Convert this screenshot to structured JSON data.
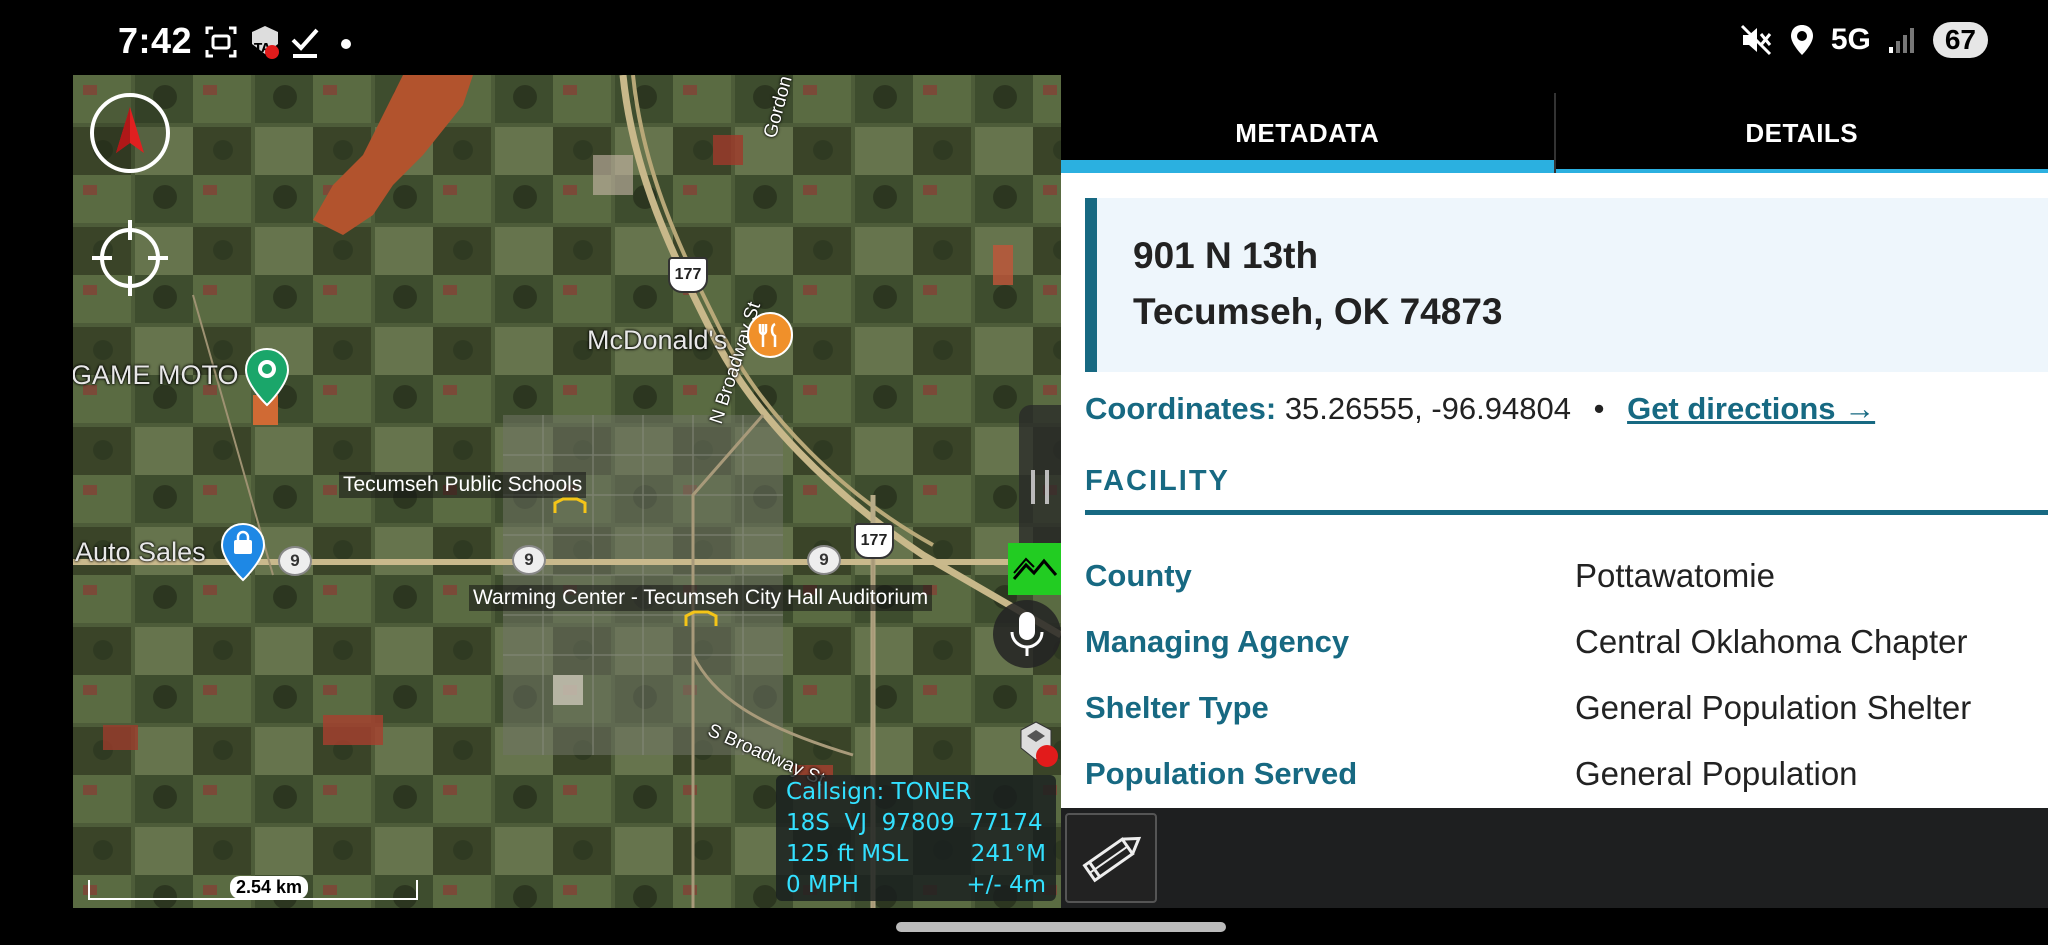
{
  "status_bar": {
    "time": "7:42",
    "network": "5G",
    "battery": "67",
    "icons": [
      "screenshot-icon",
      "tak-notification-icon",
      "check-icon",
      "dot-icon",
      "mute-icon",
      "location-icon",
      "signal-icon",
      "battery-icon"
    ]
  },
  "map": {
    "labels": {
      "mcdonalds": "McDonald's",
      "game_moto": "GAME MOTO",
      "auto_sales": "Auto Sales",
      "gordon_cooper": "Gordon Cooper D",
      "n_broadway": "N Broadway St",
      "s_broadway": "S Broadway St"
    },
    "poi": {
      "schools": "Tecumseh Public Schools",
      "warming_center": "Warming Center - Tecumseh City Hall Auditorium"
    },
    "shields": {
      "hwy177_north": "177",
      "hwy177_south": "177",
      "route9_a": "9",
      "route9_b": "9",
      "route9_c": "9"
    },
    "scale": "2.54 km",
    "info": {
      "callsign": "Callsign: TONER",
      "grid": "18S  VJ  97809  77174",
      "altitude": "125 ft MSL",
      "heading": "241°M",
      "speed": "0 MPH",
      "accuracy": "+/- 4m"
    },
    "colors": {
      "info_text": "#33e0ff",
      "green_tool": "#22cc22",
      "food_pin": "#f0902a",
      "park_pin": "#1aa66a",
      "shop_pin": "#1e88e5"
    }
  },
  "tabs": {
    "metadata": "METADATA",
    "details": "DETAILS"
  },
  "details": {
    "address_line1": "901 N 13th",
    "address_line2": "Tecumseh, OK 74873",
    "coordinates_label": "Coordinates:",
    "coordinates_value": "35.26555, -96.94804",
    "separator": "•",
    "directions_link": "Get directions →",
    "section_title": "FACILITY",
    "facility": [
      {
        "key": "County",
        "value": "Pottawatomie"
      },
      {
        "key": "Managing Agency",
        "value": "Central Oklahoma Chapter"
      },
      {
        "key": "Shelter Type",
        "value": "General Population Shelter"
      },
      {
        "key": "Population Served",
        "value": "General Population"
      }
    ],
    "accent_color": "#176982"
  }
}
